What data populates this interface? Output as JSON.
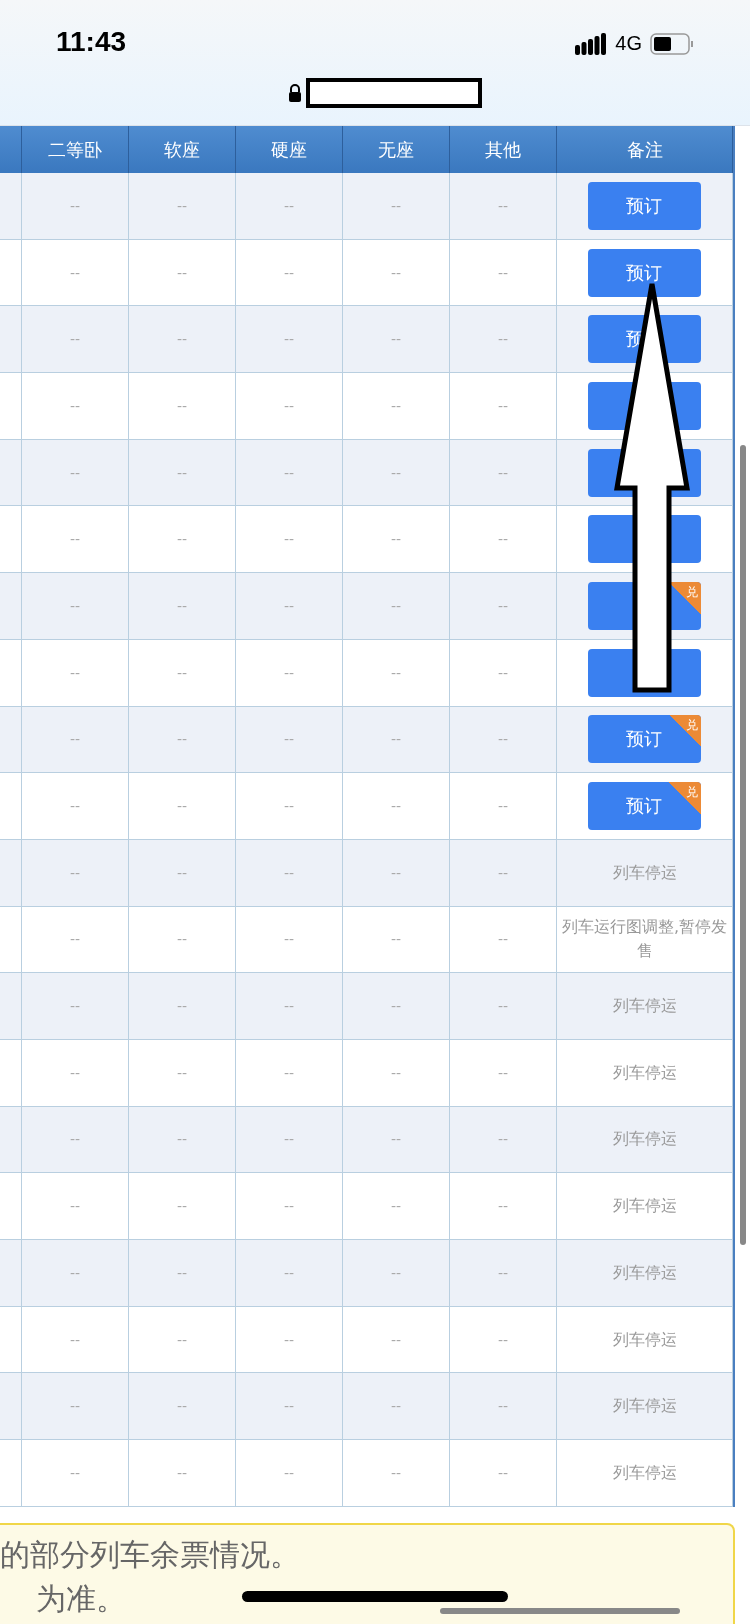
{
  "status_bar": {
    "time": "11:43",
    "network": "4G"
  },
  "table": {
    "columns": [
      "二等卧",
      "软座",
      "硬座",
      "无座",
      "其他",
      "备注"
    ],
    "rows": [
      {
        "cells": [
          "--",
          "--",
          "--",
          "--",
          "--"
        ],
        "remark": {
          "kind": "button",
          "label": "预订"
        }
      },
      {
        "cells": [
          "--",
          "--",
          "--",
          "--",
          "--"
        ],
        "remark": {
          "kind": "button",
          "label": "预订"
        }
      },
      {
        "cells": [
          "--",
          "--",
          "--",
          "--",
          "--"
        ],
        "remark": {
          "kind": "button",
          "label": "预"
        }
      },
      {
        "cells": [
          "--",
          "--",
          "--",
          "--",
          "--"
        ],
        "remark": {
          "kind": "button"
        }
      },
      {
        "cells": [
          "--",
          "--",
          "--",
          "--",
          "--"
        ],
        "remark": {
          "kind": "button"
        }
      },
      {
        "cells": [
          "--",
          "--",
          "--",
          "--",
          "--"
        ],
        "remark": {
          "kind": "button"
        }
      },
      {
        "cells": [
          "--",
          "--",
          "--",
          "--",
          "--"
        ],
        "remark": {
          "kind": "button",
          "badge": "兑"
        }
      },
      {
        "cells": [
          "--",
          "--",
          "--",
          "--",
          "--"
        ],
        "remark": {
          "kind": "button"
        }
      },
      {
        "cells": [
          "--",
          "--",
          "--",
          "--",
          "--"
        ],
        "remark": {
          "kind": "button",
          "label": "预订",
          "badge": "兑"
        }
      },
      {
        "cells": [
          "--",
          "--",
          "--",
          "--",
          "--"
        ],
        "remark": {
          "kind": "button",
          "label": "预订",
          "badge": "兑"
        }
      },
      {
        "cells": [
          "--",
          "--",
          "--",
          "--",
          "--"
        ],
        "remark": {
          "kind": "text",
          "text": "列车停运"
        }
      },
      {
        "cells": [
          "--",
          "--",
          "--",
          "--",
          "--"
        ],
        "remark": {
          "kind": "text",
          "text": "列车运行图调整,暂停发售"
        }
      },
      {
        "cells": [
          "--",
          "--",
          "--",
          "--",
          "--"
        ],
        "remark": {
          "kind": "text",
          "text": "列车停运"
        }
      },
      {
        "cells": [
          "--",
          "--",
          "--",
          "--",
          "--"
        ],
        "remark": {
          "kind": "text",
          "text": "列车停运"
        }
      },
      {
        "cells": [
          "--",
          "--",
          "--",
          "--",
          "--"
        ],
        "remark": {
          "kind": "text",
          "text": "列车停运"
        }
      },
      {
        "cells": [
          "--",
          "--",
          "--",
          "--",
          "--"
        ],
        "remark": {
          "kind": "text",
          "text": "列车停运"
        }
      },
      {
        "cells": [
          "--",
          "--",
          "--",
          "--",
          "--"
        ],
        "remark": {
          "kind": "text",
          "text": "列车停运"
        }
      },
      {
        "cells": [
          "--",
          "--",
          "--",
          "--",
          "--"
        ],
        "remark": {
          "kind": "text",
          "text": "列车停运"
        }
      },
      {
        "cells": [
          "--",
          "--",
          "--",
          "--",
          "--"
        ],
        "remark": {
          "kind": "text",
          "text": "列车停运"
        }
      },
      {
        "cells": [
          "--",
          "--",
          "--",
          "--",
          "--"
        ],
        "remark": {
          "kind": "text",
          "text": "列车停运"
        }
      }
    ]
  },
  "notice": {
    "lines": [
      "的部分列车余票情况。",
      "为准。"
    ]
  }
}
